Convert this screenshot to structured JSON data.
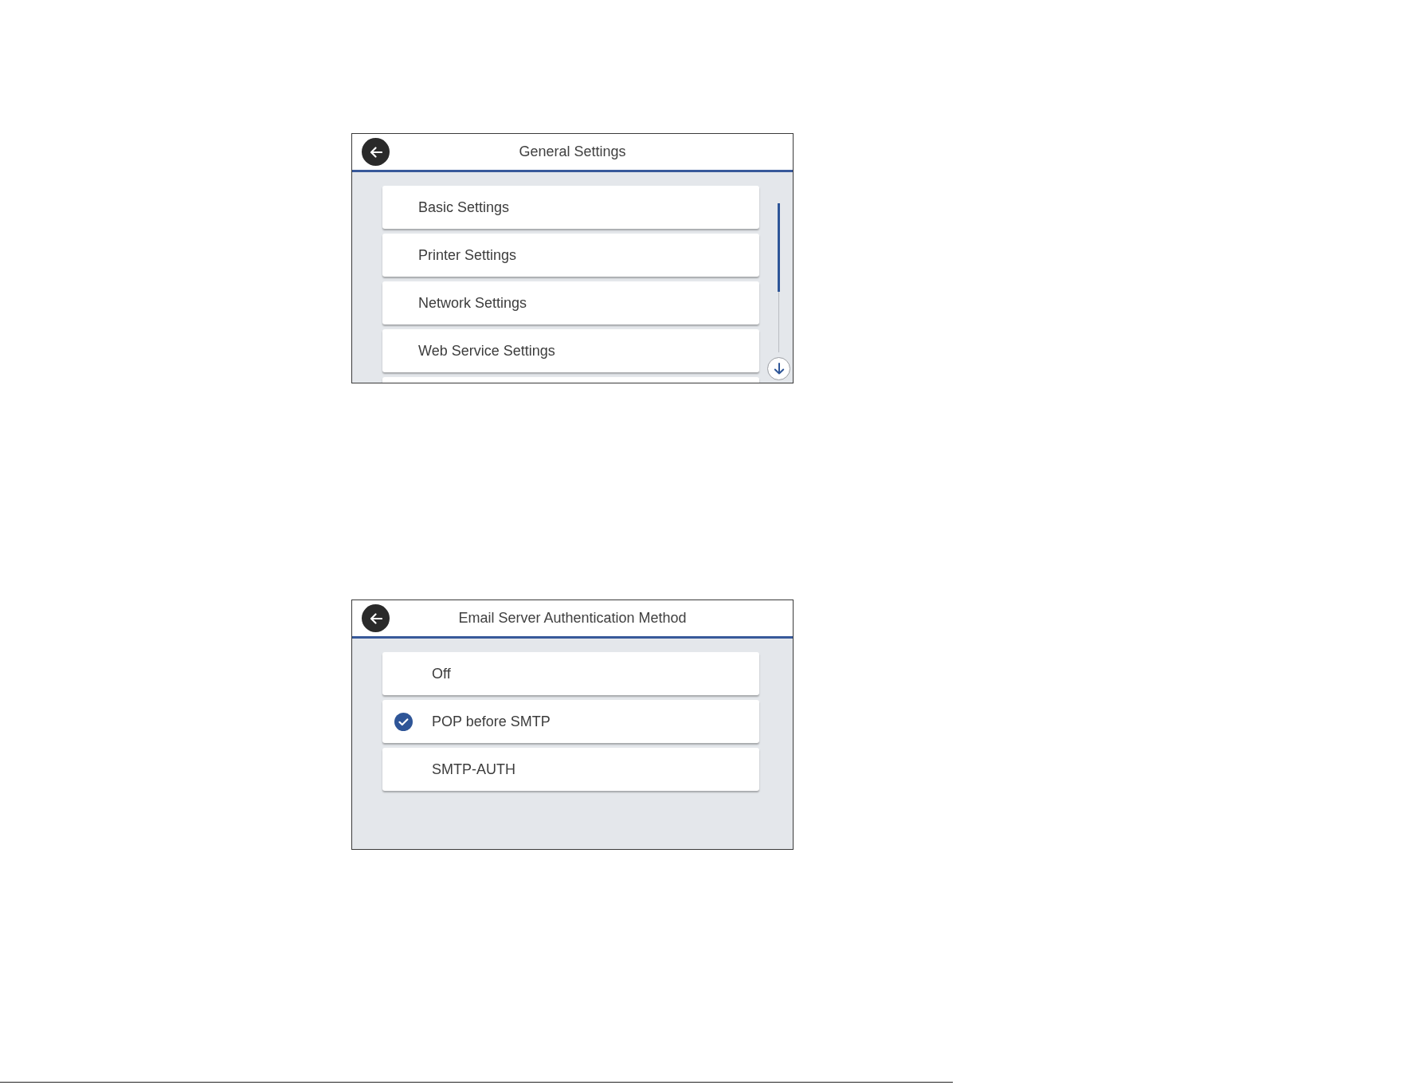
{
  "screens": [
    {
      "kind": "menu",
      "title": "General Settings",
      "items": [
        {
          "label": "Basic Settings"
        },
        {
          "label": "Printer Settings"
        },
        {
          "label": "Network Settings"
        },
        {
          "label": "Web Service Settings"
        }
      ]
    },
    {
      "kind": "choice",
      "title": "Email Server Authentication Method",
      "items": [
        {
          "label": "Off",
          "selected": false
        },
        {
          "label": "POP before SMTP",
          "selected": true
        },
        {
          "label": "SMTP-AUTH",
          "selected": false
        }
      ]
    }
  ]
}
